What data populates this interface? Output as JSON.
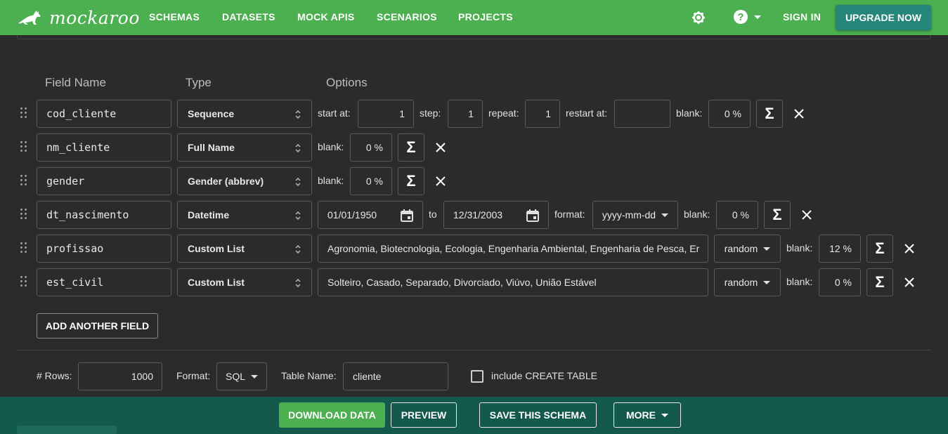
{
  "header": {
    "logo_text": "mockaroo",
    "nav": [
      "SCHEMAS",
      "DATASETS",
      "MOCK APIS",
      "SCENARIOS",
      "PROJECTS"
    ],
    "sign_in": "SIGN IN",
    "upgrade": "UPGRADE NOW",
    "icons": [
      "kangaroo-logo-icon",
      "theme-brightness-icon",
      "help-icon",
      "chevron-down-icon"
    ]
  },
  "columns": {
    "field_name": "Field Name",
    "type": "Type",
    "options": "Options"
  },
  "labels": {
    "start_at": "start at:",
    "step": "step:",
    "repeat": "repeat:",
    "restart_at": "restart at:",
    "blank": "blank:",
    "to": "to",
    "format": "format:",
    "sigma": "Σ"
  },
  "fields": [
    {
      "name": "cod_cliente",
      "type": "Sequence",
      "start_at": "1",
      "step": "1",
      "repeat": "1",
      "restart_at": "",
      "blank": "0 %"
    },
    {
      "name": "nm_cliente",
      "type": "Full Name",
      "blank": "0 %"
    },
    {
      "name": "gender",
      "type": "Gender (abbrev)",
      "blank": "0 %"
    },
    {
      "name": "dt_nascimento",
      "type": "Datetime",
      "from": "01/01/1950",
      "to": "12/31/2003",
      "format": "yyyy-mm-dd",
      "blank": "0 %"
    },
    {
      "name": "profissao",
      "type": "Custom List",
      "values": "Agronomia, Biotecnologia, Ecologia, Engenharia Ambiental, Engenharia de Pesca, Er",
      "order": "random",
      "blank": "12 %"
    },
    {
      "name": "est_civil",
      "type": "Custom List",
      "values": "Solteiro, Casado, Separado, Divorciado, Viúvo, União Estável",
      "order": "random",
      "blank": "0 %"
    }
  ],
  "add_field": "ADD ANOTHER FIELD",
  "settings": {
    "rows_label": "# Rows:",
    "rows": "1000",
    "format_label": "Format:",
    "format": "SQL",
    "table_name_label": "Table Name:",
    "table_name": "cliente",
    "include_create_label": "include CREATE TABLE",
    "include_create_checked": false
  },
  "actions": {
    "download": "DOWNLOAD DATA",
    "preview": "PREVIEW",
    "save": "SAVE THIS SCHEMA",
    "more": "MORE"
  }
}
